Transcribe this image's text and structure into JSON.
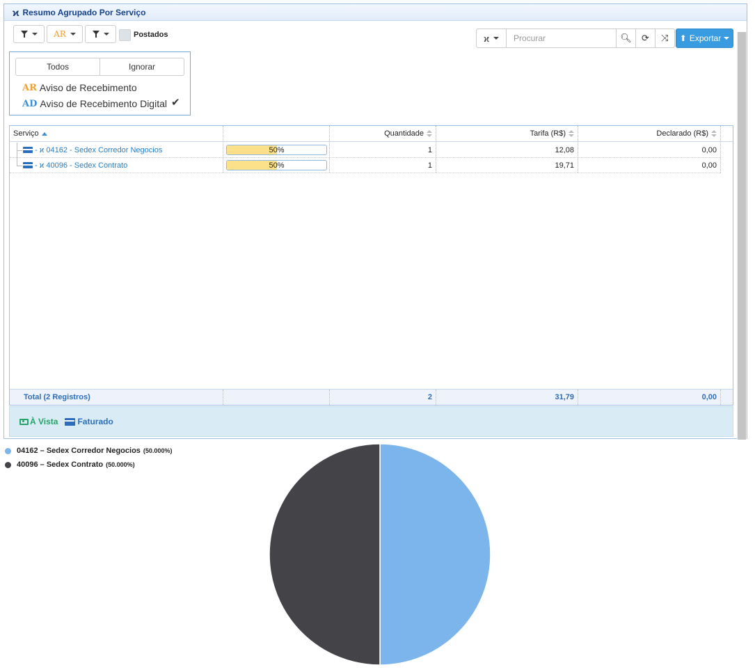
{
  "panel": {
    "title": "Resumo Agrupado Por Serviço"
  },
  "toolbar": {
    "ar_label": "AR",
    "postados_label": "Postados",
    "search_placeholder": "Procurar",
    "export_label": "Exportar"
  },
  "dropdown": {
    "todos": "Todos",
    "ignorar": "Ignorar",
    "items": [
      {
        "abbr": "AR",
        "label": "Aviso de Recebimento",
        "color": "#f0a030",
        "checked": false
      },
      {
        "abbr": "AD",
        "label": "Aviso de Recebimento Digital",
        "color": "#3a8fd8",
        "checked": true
      }
    ]
  },
  "grid": {
    "columns": {
      "servico": "Serviço",
      "quantidade": "Quantidade",
      "tarifa": "Tarifa (R$)",
      "declarado": "Declarado (R$)"
    },
    "rows": [
      {
        "service": "04162 - Sedex Corredor Negocios",
        "progress_label": "50%",
        "progress": 0.5,
        "quantidade": "1",
        "tarifa": "12,08",
        "declarado": "0,00"
      },
      {
        "service": "40096 - Sedex Contrato",
        "progress_label": "50%",
        "progress": 0.5,
        "quantidade": "1",
        "tarifa": "19,71",
        "declarado": "0,00"
      }
    ],
    "footer": {
      "label": "Total (2 Registros)",
      "quantidade": "2",
      "tarifa": "31,79",
      "declarado": "0,00"
    }
  },
  "legend_bar": {
    "a_vista": "À Vista",
    "faturado": "Faturado"
  },
  "chart_data": {
    "type": "pie",
    "categories": [
      "04162 – Sedex Corredor Negocios",
      "40096 – Sedex Contrato"
    ],
    "values": [
      50,
      50
    ],
    "percent_labels": [
      "(50.000%)",
      "(50.000%)"
    ],
    "colors": [
      "#7cb5ec",
      "#434348"
    ],
    "legend_position": "top-left"
  }
}
